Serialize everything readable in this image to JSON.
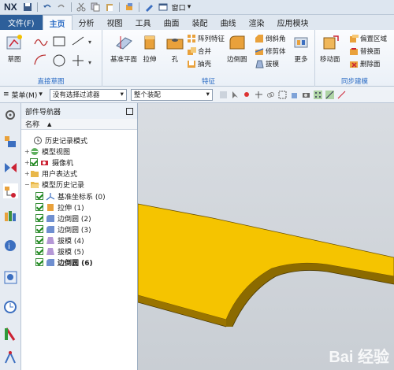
{
  "app": {
    "logo": "NX",
    "window_menu": "窗口"
  },
  "tabs": [
    "文件(F)",
    "主页",
    "分析",
    "视图",
    "工具",
    "曲面",
    "装配",
    "曲线",
    "渲染",
    "应用模块"
  ],
  "ribbon": {
    "groups": {
      "sketch": "直接草图",
      "feature": "特征",
      "sync": "同步建模"
    },
    "sketch_btn": "草图",
    "datum_plane": "基准平面",
    "extrude": "拉伸",
    "hole": "孔",
    "pattern_feature": "阵列特征",
    "unite": "合并",
    "shell": "抽壳",
    "edge_blend": "边倒圆",
    "chamfer": "倒斜角",
    "trim_body": "修剪体",
    "draft": "拔模",
    "more": "更多",
    "move_face": "移动面",
    "offset_region": "偏置区域",
    "replace_face": "替换面",
    "delete_face": "删除面"
  },
  "filterbar": {
    "menu": "菜单(M)",
    "filter_value": "没有选择过滤器",
    "assembly_value": "整个装配"
  },
  "navigator": {
    "title": "部件导航器",
    "col_name": "名称",
    "rows": [
      {
        "label": "历史记录模式"
      },
      {
        "label": "模型视图"
      },
      {
        "label": "摄像机"
      },
      {
        "label": "用户表达式"
      },
      {
        "label": "模型历史记录"
      },
      {
        "label": "基准坐标系 (0)"
      },
      {
        "label": "拉伸 (1)"
      },
      {
        "label": "边倒圆 (2)"
      },
      {
        "label": "边倒圆 (3)"
      },
      {
        "label": "拔模 (4)"
      },
      {
        "label": "拔模 (5)"
      },
      {
        "label": "边倒圆 (6)"
      }
    ]
  },
  "watermark": "Bai 经验",
  "colors": {
    "part": "#f5c400",
    "part_side": "#8b6a00",
    "accent": "#2a6bc4"
  }
}
